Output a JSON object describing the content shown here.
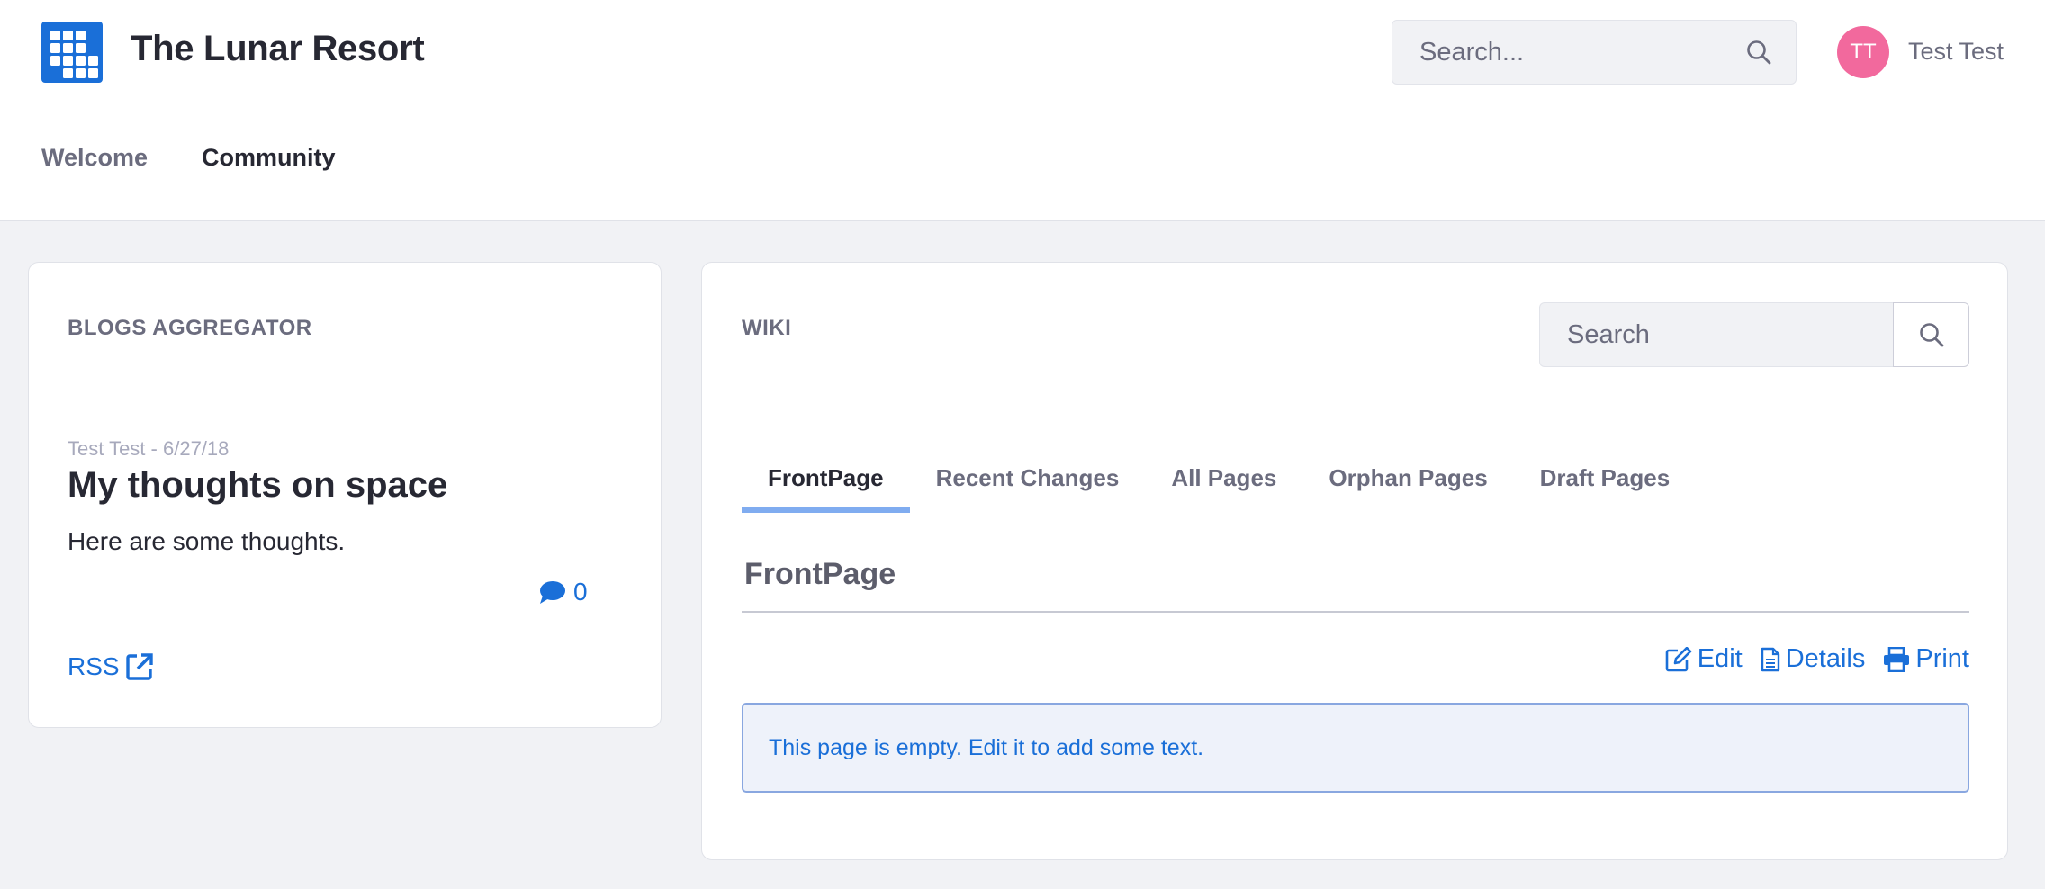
{
  "header": {
    "site_title": "The Lunar Resort",
    "search_placeholder": "Search...",
    "user": {
      "initials": "TT",
      "name": "Test Test",
      "avatar_color": "#f2699d"
    },
    "nav": [
      {
        "label": "Welcome",
        "active": false
      },
      {
        "label": "Community",
        "active": true
      }
    ]
  },
  "blogs": {
    "title": "BLOGS AGGREGATOR",
    "entry": {
      "author": "Test Test",
      "separator": " - ",
      "date": "6/27/18",
      "title": "My thoughts on space",
      "summary": "Here are some thoughts.",
      "comment_count": "0",
      "comment_icon": "comment-icon"
    },
    "rss_label": "RSS",
    "rss_icon": "external-link-icon"
  },
  "wiki": {
    "title": "WIKI",
    "search_placeholder": "Search",
    "tabs": [
      {
        "label": "FrontPage",
        "active": true
      },
      {
        "label": "Recent Changes",
        "active": false
      },
      {
        "label": "All Pages",
        "active": false
      },
      {
        "label": "Orphan Pages",
        "active": false
      },
      {
        "label": "Draft Pages",
        "active": false
      }
    ],
    "page_title": "FrontPage",
    "actions": [
      {
        "label": "Edit",
        "icon": "edit-icon"
      },
      {
        "label": "Details",
        "icon": "document-icon"
      },
      {
        "label": "Print",
        "icon": "print-icon"
      }
    ],
    "empty_message": "This page is empty. Edit it to add some text."
  },
  "colors": {
    "accent": "#1a6fd8",
    "background": "#f1f2f5",
    "tab_active_underline": "#80acf0"
  }
}
